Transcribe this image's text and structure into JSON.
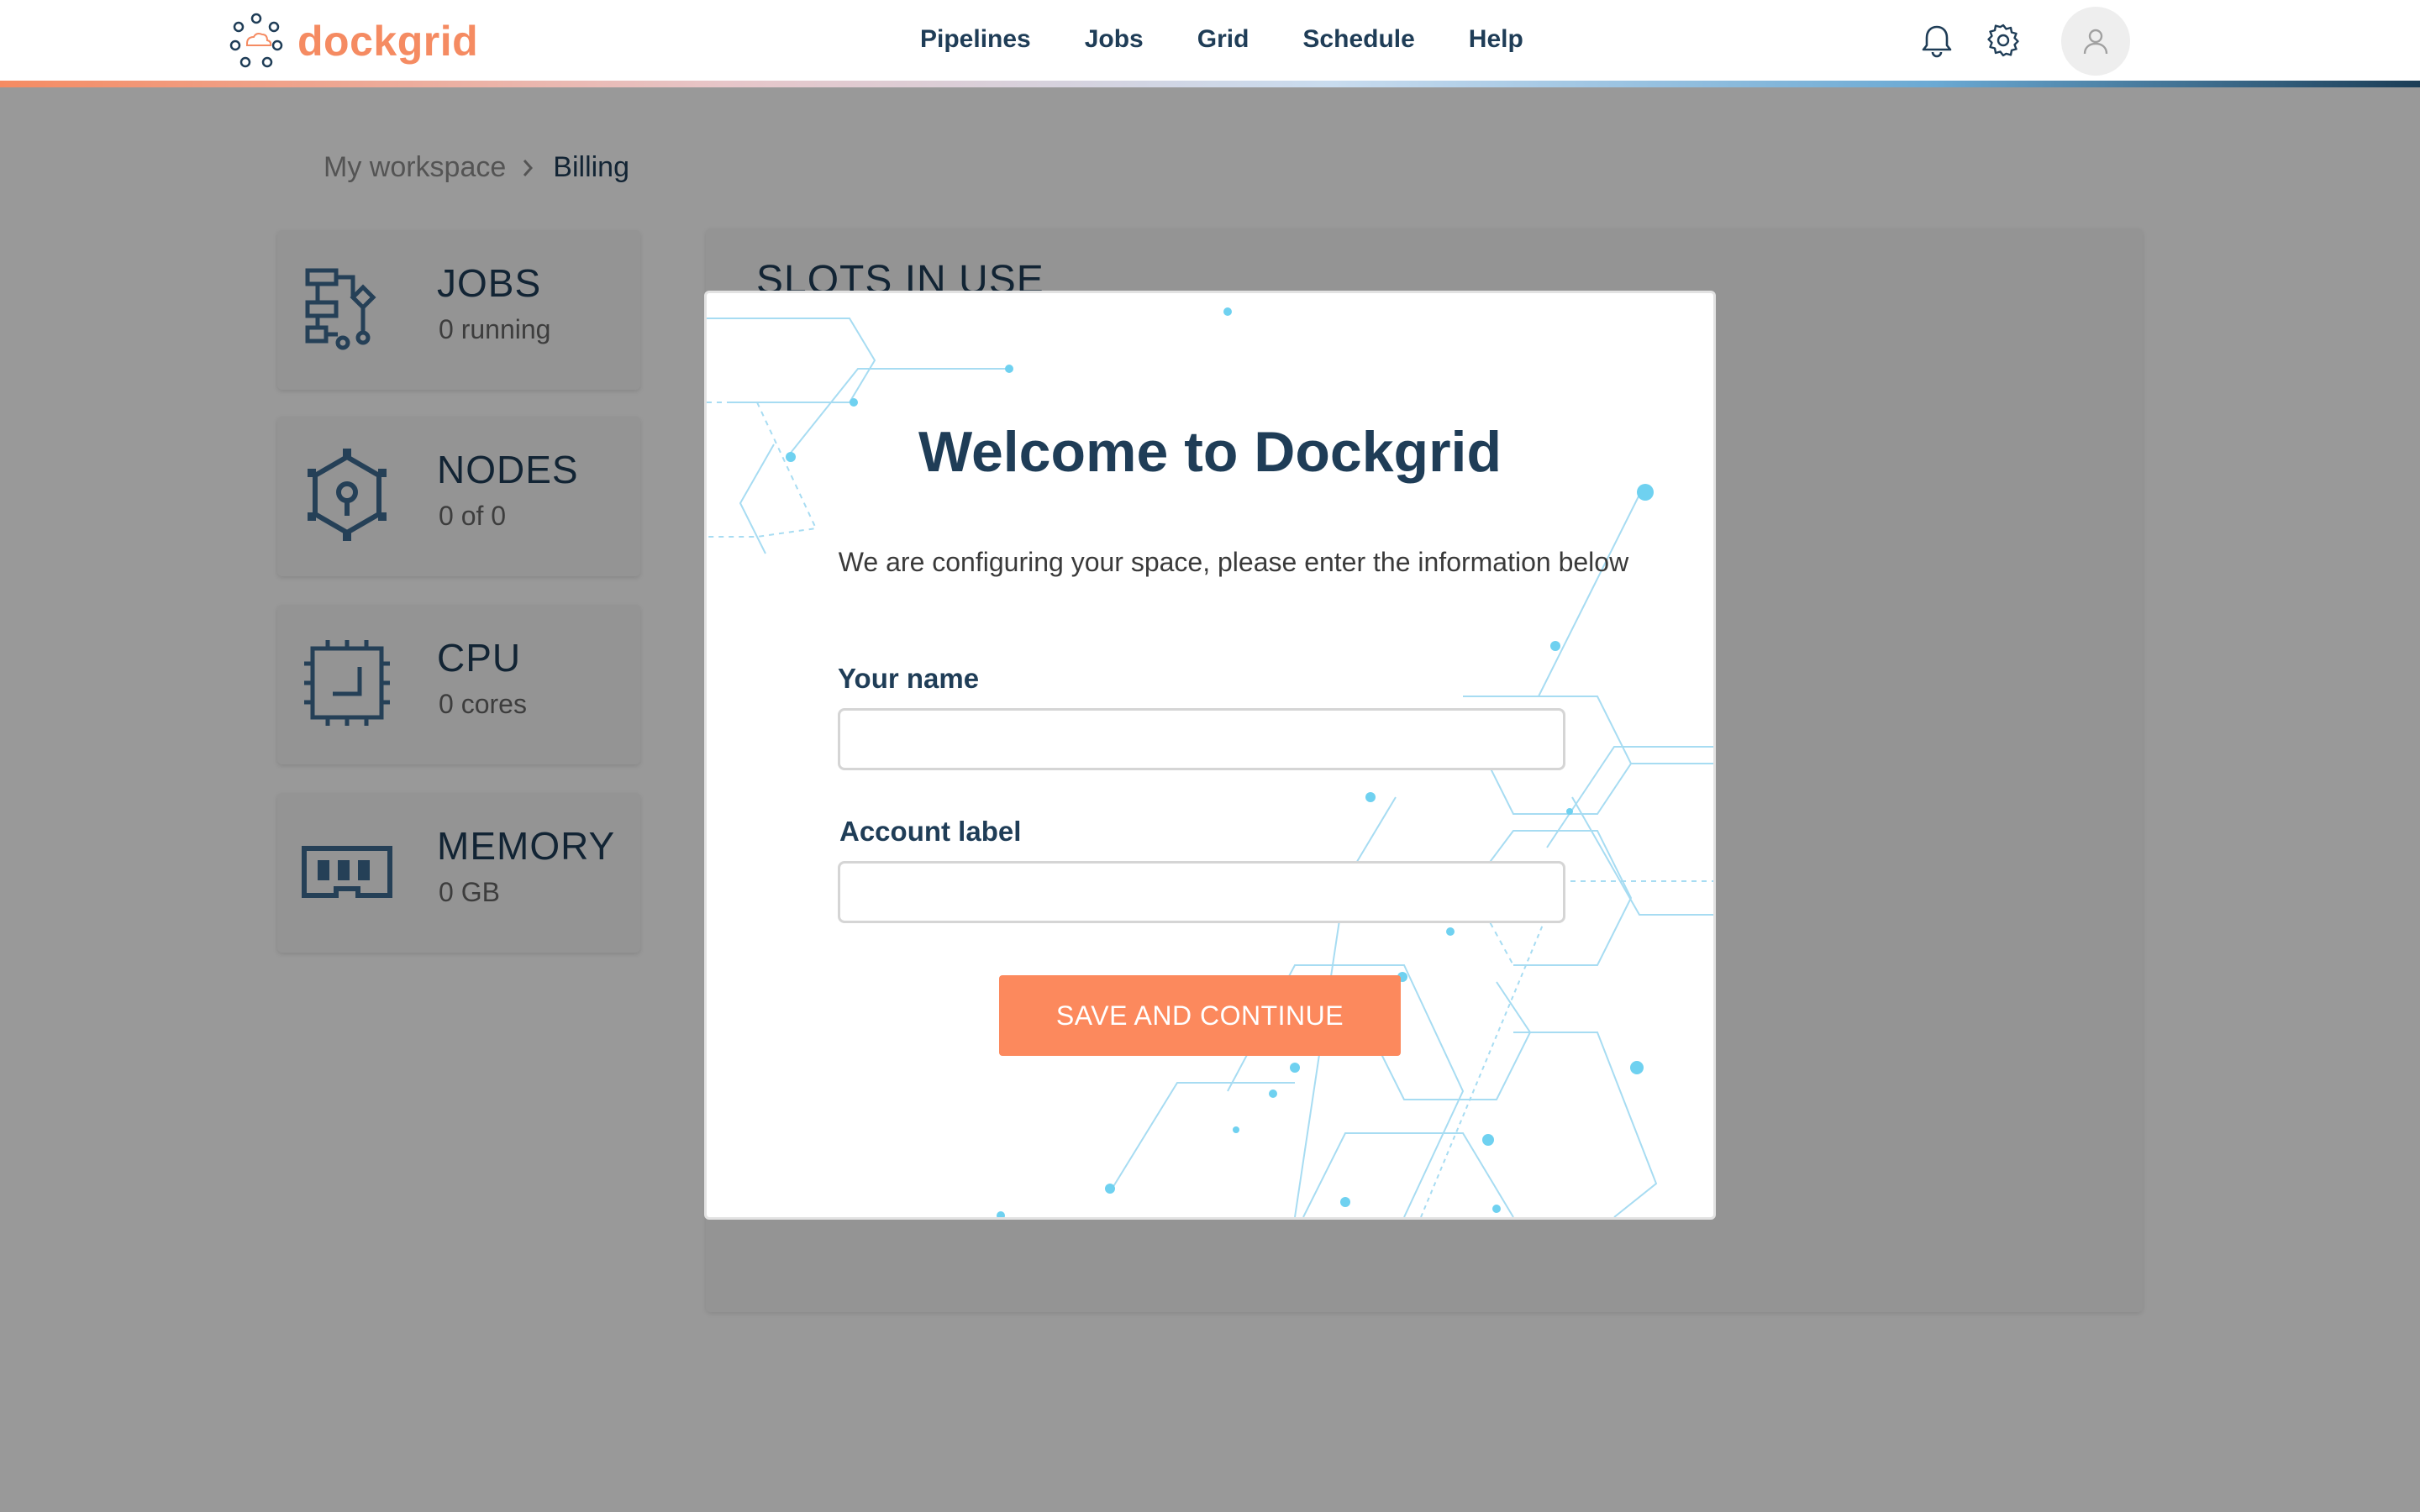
{
  "app": {
    "brand_name": "dockgrid",
    "accent_color": "#fc895d",
    "primary_text_color": "#1f3d57"
  },
  "header": {
    "nav": [
      {
        "label": "Pipelines"
      },
      {
        "label": "Jobs"
      },
      {
        "label": "Grid"
      },
      {
        "label": "Schedule"
      },
      {
        "label": "Help"
      }
    ],
    "icons": [
      "bell-icon",
      "gear-icon",
      "user-icon"
    ]
  },
  "breadcrumb": {
    "root": "My workspace",
    "current": "Billing"
  },
  "stats": [
    {
      "title": "JOBS",
      "value": "0 running",
      "icon": "pipeline-icon"
    },
    {
      "title": "NODES",
      "value": "0 of 0",
      "icon": "node-icon"
    },
    {
      "title": "CPU",
      "value": "0 cores",
      "icon": "cpu-icon"
    },
    {
      "title": "MEMORY",
      "value": "0 GB",
      "icon": "memory-icon"
    }
  ],
  "slots": {
    "title": "SLOTS IN USE"
  },
  "modal": {
    "title": "Welcome to Dockgrid",
    "subtitle": "We are configuring your space, please enter the information below",
    "fields": [
      {
        "label": "Your name",
        "value": "",
        "placeholder": ""
      },
      {
        "label": "Account label",
        "value": "",
        "placeholder": ""
      }
    ],
    "submit_label": "SAVE AND CONTINUE"
  }
}
